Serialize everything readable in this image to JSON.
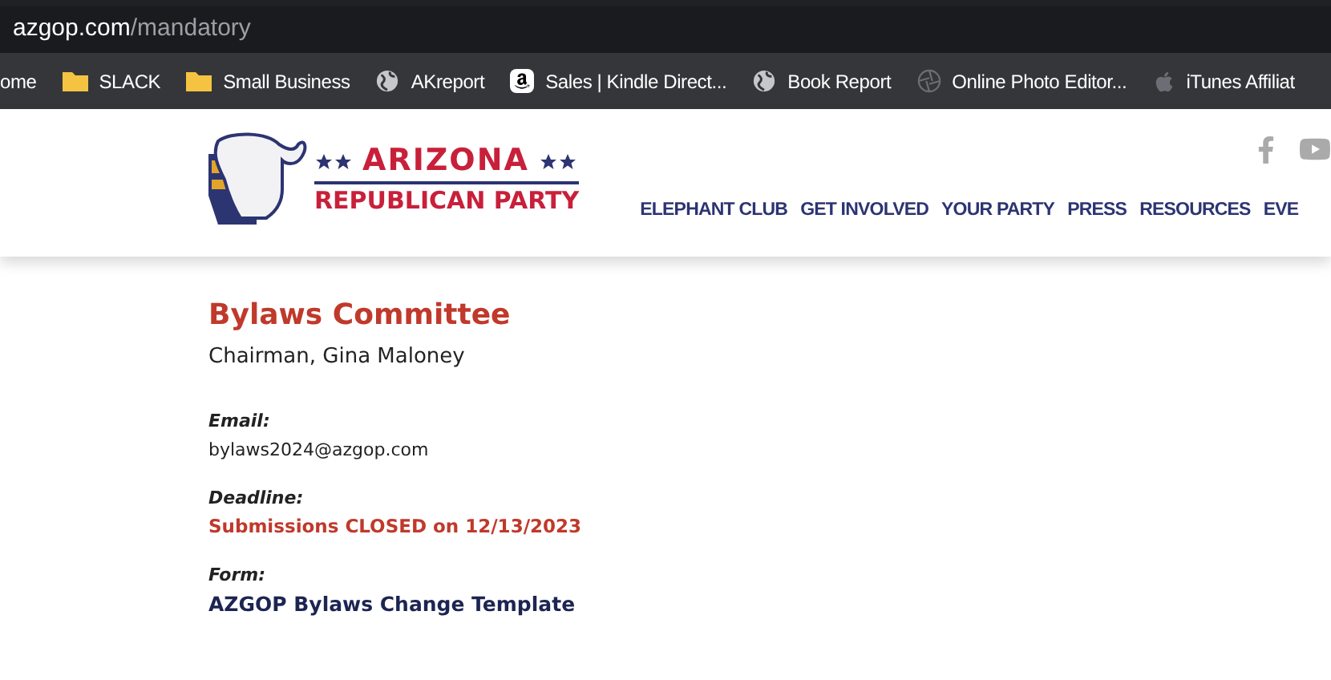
{
  "address_bar": {
    "domain": "azgop.com",
    "path": "/mandatory"
  },
  "bookmarks": [
    {
      "label": "ome",
      "kind": "plain"
    },
    {
      "label": "SLACK",
      "kind": "folder"
    },
    {
      "label": "Small Business",
      "kind": "folder"
    },
    {
      "label": "AKreport",
      "kind": "site"
    },
    {
      "label": "Sales | Kindle Direct...",
      "kind": "store"
    },
    {
      "label": "Book Report",
      "kind": "site"
    },
    {
      "label": "Online Photo Editor...",
      "kind": "editor"
    },
    {
      "label": "iTunes Affiliat",
      "kind": "music"
    }
  ],
  "logo": {
    "line_1": "ARIZONA",
    "line_2": "REPUBLICAN PARTY"
  },
  "nav": [
    "ELEPHANT CLUB",
    "GET INVOLVED",
    "YOUR PARTY",
    "PRESS",
    "RESOURCES",
    "EVE"
  ],
  "committee": {
    "title": "Bylaws Committee",
    "chairman": "Chairman, Gina Maloney",
    "fields": [
      {
        "label": "Email:",
        "value": "bylaws2024@azgop.com",
        "kind": "plain"
      },
      {
        "label": "Deadline:",
        "value": "Submissions CLOSED on 12/13/2023",
        "kind": "alert"
      },
      {
        "label": "Form:",
        "value": "AZGOP Bylaws Change Template",
        "kind": "link"
      }
    ]
  }
}
